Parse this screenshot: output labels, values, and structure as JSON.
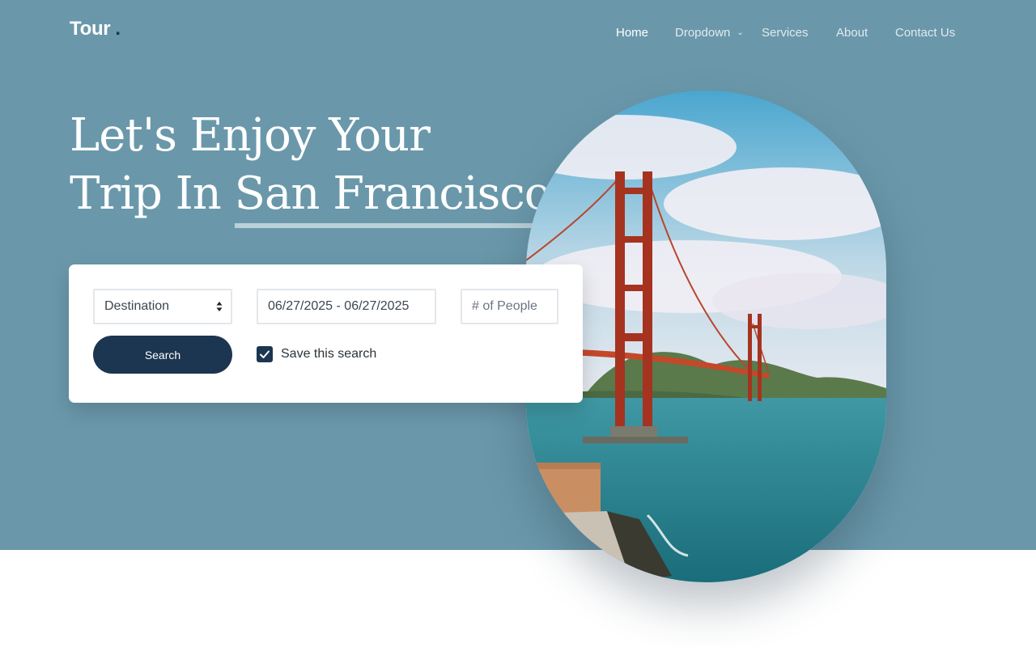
{
  "brand": {
    "name": "Tour",
    "dot": "."
  },
  "nav": {
    "items": [
      {
        "label": "Home",
        "active": true
      },
      {
        "label": "Dropdown",
        "has_dropdown": true
      },
      {
        "label": "Services"
      },
      {
        "label": "About"
      },
      {
        "label": "Contact Us"
      }
    ]
  },
  "hero": {
    "headline_line1": "Let's Enjoy Your",
    "headline_prefix": "Trip In ",
    "headline_city": "San Francisco",
    "headline_end": ".",
    "image_icon": "golden-gate-bridge-photo"
  },
  "search": {
    "destination_value": "Destination",
    "date_range_value": "06/27/2025 - 06/27/2025",
    "people_placeholder": "# of People",
    "button_label": "Search",
    "save_label": "Save this search",
    "save_checked": true
  },
  "colors": {
    "hero_bg": "#6a98aa",
    "primary": "#1c3550",
    "card_bg": "#ffffff",
    "page_bg": "#ffffff"
  }
}
